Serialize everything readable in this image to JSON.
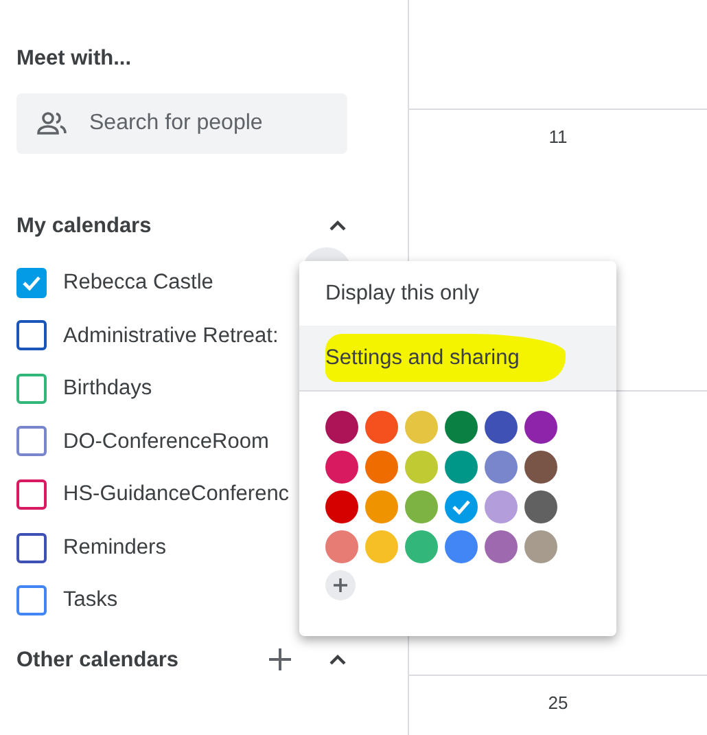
{
  "meet_with": {
    "title": "Meet with...",
    "search": {
      "placeholder": "Search for people"
    }
  },
  "my_calendars": {
    "title": "My calendars",
    "expanded": true,
    "items": [
      {
        "label": "Rebecca Castle",
        "checked": true,
        "color": "#039be5"
      },
      {
        "label": "Administrative Retreat:",
        "checked": false,
        "color": "#1a56b8"
      },
      {
        "label": "Birthdays",
        "checked": false,
        "color": "#33b679"
      },
      {
        "label": "DO-ConferenceRoom",
        "checked": false,
        "color": "#7986cb"
      },
      {
        "label": "HS-GuidanceConferenc",
        "checked": false,
        "color": "#d81b60"
      },
      {
        "label": "Reminders",
        "checked": false,
        "color": "#3f51b5"
      },
      {
        "label": "Tasks",
        "checked": false,
        "color": "#4285f4"
      }
    ]
  },
  "other_calendars": {
    "title": "Other calendars",
    "expanded": true
  },
  "calendar_grid": {
    "day_numbers": [
      "11",
      "25"
    ]
  },
  "context_menu": {
    "items": [
      {
        "label": "Display this only",
        "selected": false,
        "highlighted": false
      },
      {
        "label": "Settings and sharing",
        "selected": true,
        "highlighted": true
      }
    ],
    "swatches": [
      {
        "color": "#ad1457",
        "selected": false
      },
      {
        "color": "#f4511e",
        "selected": false
      },
      {
        "color": "#e4c441",
        "selected": false
      },
      {
        "color": "#0b8043",
        "selected": false
      },
      {
        "color": "#3f51b5",
        "selected": false
      },
      {
        "color": "#8e24aa",
        "selected": false
      },
      {
        "color": "#d81b60",
        "selected": false
      },
      {
        "color": "#ef6c00",
        "selected": false
      },
      {
        "color": "#c0ca33",
        "selected": false
      },
      {
        "color": "#009688",
        "selected": false
      },
      {
        "color": "#7986cb",
        "selected": false
      },
      {
        "color": "#795548",
        "selected": false
      },
      {
        "color": "#d50000",
        "selected": false
      },
      {
        "color": "#f09300",
        "selected": false
      },
      {
        "color": "#7cb342",
        "selected": false
      },
      {
        "color": "#039be5",
        "selected": true
      },
      {
        "color": "#b39ddb",
        "selected": false
      },
      {
        "color": "#616161",
        "selected": false
      },
      {
        "color": "#e67c73",
        "selected": false
      },
      {
        "color": "#f6bf26",
        "selected": false
      },
      {
        "color": "#33b679",
        "selected": false
      },
      {
        "color": "#4285f4",
        "selected": false
      },
      {
        "color": "#9e69af",
        "selected": false
      },
      {
        "color": "#a79b8e",
        "selected": false
      }
    ]
  }
}
